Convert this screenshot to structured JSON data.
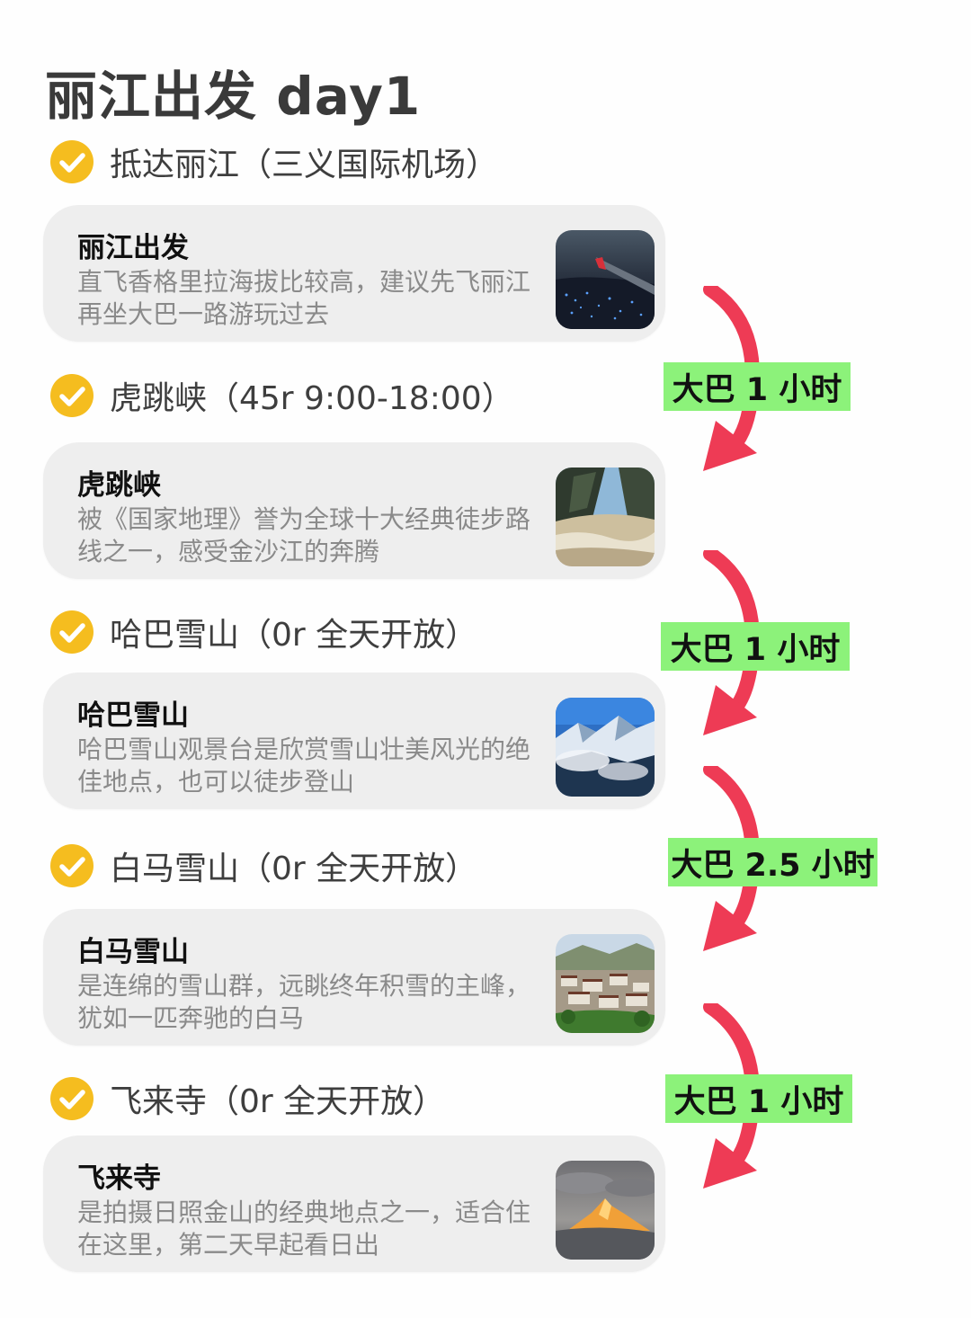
{
  "title": "丽江出发 day1",
  "colors": {
    "check": "#f5bd1f",
    "card_bg": "#eeeeee",
    "arrow": "#ee3b55",
    "bus_label_bg": "#8cf27a"
  },
  "steps": [
    {
      "heading": "抵达丽江（三义国际机场）",
      "card_title": "丽江出发",
      "card_desc": "直飞香格里拉海拔比较高，建议先飞丽江再坐大巴一路游玩过去",
      "thumb_icon": "airplane-window-night-city"
    },
    {
      "heading": "虎跳峡（45r 9:00-18:00）",
      "card_title": "虎跳峡",
      "card_desc": "被《国家地理》誉为全球十大经典徒步路线之一，感受金沙江的奔腾",
      "thumb_icon": "gorge-river-rapids"
    },
    {
      "heading": "哈巴雪山（0r  全天开放）",
      "card_title": "哈巴雪山",
      "card_desc": "哈巴雪山观景台是欣赏雪山壮美风光的绝佳地点，也可以徒步登山",
      "thumb_icon": "snow-mountain-clouds"
    },
    {
      "heading": "白马雪山（0r  全天开放）",
      "card_title": "白马雪山",
      "card_desc": "是连绵的雪山群，远眺终年积雪的主峰，犹如一匹奔驰的白马",
      "thumb_icon": "mountain-village"
    },
    {
      "heading": "飞来寺（0r  全天开放）",
      "card_title": "飞来寺",
      "card_desc": "是拍摄日照金山的经典地点之一，适合住在这里，第二天早起看日出",
      "thumb_icon": "golden-peak-sunrise"
    }
  ],
  "transfers": [
    {
      "label": "大巴 1 小时"
    },
    {
      "label": "大巴 1 小时"
    },
    {
      "label": "大巴 2.5 小时"
    },
    {
      "label": "大巴 1 小时"
    }
  ]
}
